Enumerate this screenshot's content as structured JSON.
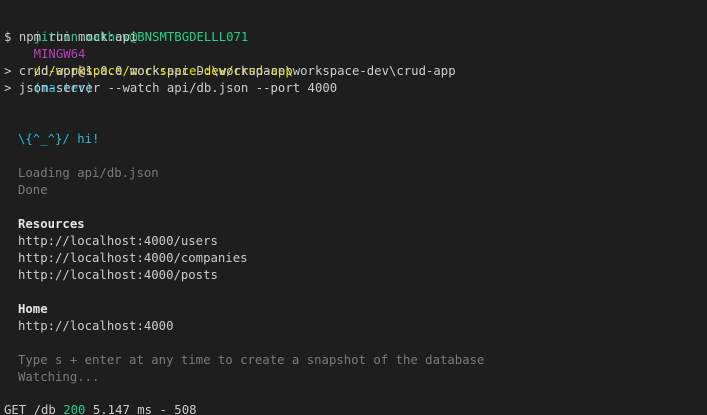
{
  "prompt": {
    "user_host": "jithin.mathew@BNSMTBGDELLL071",
    "shell": "MINGW64",
    "path": "/d/workspace/workspace-dev/crud-app",
    "branch": "(master)",
    "symbol": "$",
    "command": "npm run mock:api"
  },
  "npm_output": {
    "script_line": "> crud-app@1.0.0 mock:api D:\\workspace\\workspace-dev\\crud-app",
    "exec_line": "> json-server --watch api/db.json --port 4000"
  },
  "json_server": {
    "greeting": "\\{^_^}/ hi!",
    "loading": "Loading api/db.json",
    "done": "Done",
    "resources_heading": "Resources",
    "resources": [
      "http://localhost:4000/users",
      "http://localhost:4000/companies",
      "http://localhost:4000/posts"
    ],
    "home_heading": "Home",
    "home_url": "http://localhost:4000",
    "snapshot_hint": "Type s + enter at any time to create a snapshot of the database",
    "watching": "Watching..."
  },
  "request_log": {
    "method_path": "GET /db",
    "status": "200",
    "timing": "5.147 ms - 508"
  },
  "colors": {
    "background": "#1e1e1e",
    "user_host": "#23d18b",
    "shell": "#bc3fbc",
    "path": "#e5e510",
    "branch": "#29b8db",
    "greeting": "#29b8db",
    "status_ok": "#23d18b",
    "dim_text": "#7a7a7a"
  }
}
